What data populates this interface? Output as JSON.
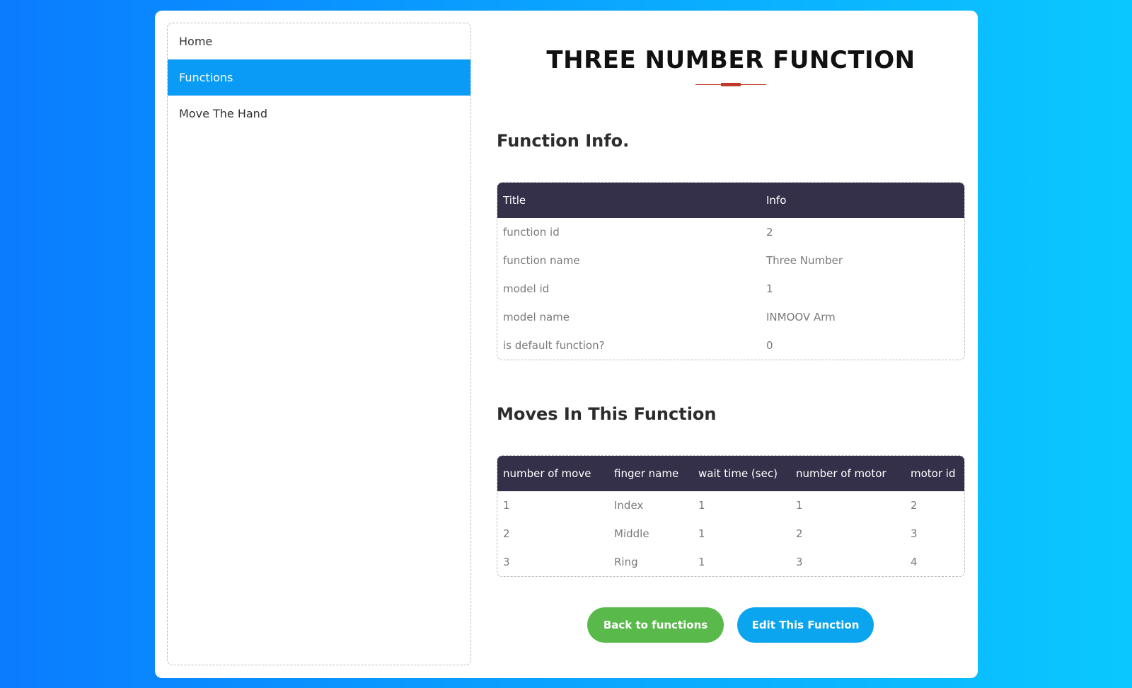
{
  "sidebar": {
    "items": [
      {
        "label": "Home",
        "active": false
      },
      {
        "label": "Functions",
        "active": true
      },
      {
        "label": "Move The Hand",
        "active": false
      }
    ]
  },
  "page": {
    "title_bold": "THREE NUMBER",
    "title_light": "FUNCTION"
  },
  "info": {
    "heading": "Function Info.",
    "columns": [
      "Title",
      "Info"
    ],
    "rows": [
      [
        "function id",
        "2"
      ],
      [
        "function name",
        "Three Number"
      ],
      [
        "model id",
        "1"
      ],
      [
        "model name",
        "INMOOV Arm"
      ],
      [
        "is default function?",
        "0"
      ]
    ]
  },
  "moves": {
    "heading": "Moves In This Function",
    "columns": [
      "number of move",
      "finger name",
      "wait time (sec)",
      "number of motor",
      "motor id"
    ],
    "rows": [
      [
        "1",
        "Index",
        "1",
        "1",
        "2"
      ],
      [
        "2",
        "Middle",
        "1",
        "2",
        "3"
      ],
      [
        "3",
        "Ring",
        "1",
        "3",
        "4"
      ]
    ]
  },
  "buttons": {
    "back_label": "Back to functions",
    "edit_label": "Edit This Function",
    "back_color": "#5ab94b",
    "edit_color": "#0aa4ef"
  },
  "colors": {
    "header_bg": "#35304a",
    "nav_active": "#0a9bf7",
    "accent_red": "#c0392b"
  }
}
